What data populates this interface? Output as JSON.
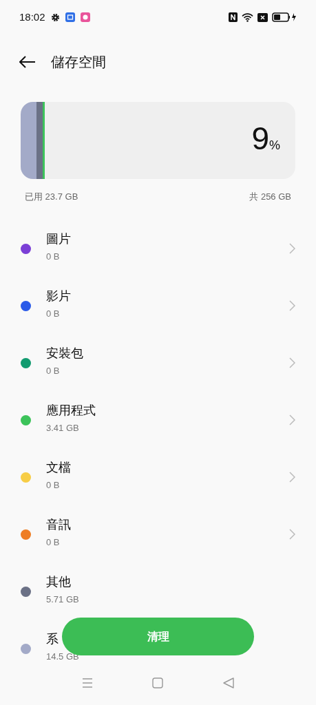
{
  "status_bar": {
    "time": "18:02"
  },
  "header": {
    "title": "儲存空間"
  },
  "usage": {
    "percent": "9",
    "percent_sign": "%",
    "used": "已用 23.7 GB",
    "total": "共 256 GB",
    "segments": [
      {
        "color": "#a3aac8"
      },
      {
        "color": "#6b7186"
      },
      {
        "color": "#3cc35a"
      }
    ]
  },
  "categories": [
    {
      "label": "圖片",
      "size": "0 B",
      "color": "#7b3fd6",
      "chevron": true
    },
    {
      "label": "影片",
      "size": "0 B",
      "color": "#2a5ae8",
      "chevron": true
    },
    {
      "label": "安裝包",
      "size": "0 B",
      "color": "#129b70",
      "chevron": true
    },
    {
      "label": "應用程式",
      "size": "3.41 GB",
      "color": "#3cc35a",
      "chevron": true
    },
    {
      "label": "文檔",
      "size": "0 B",
      "color": "#f7cd46",
      "chevron": true
    },
    {
      "label": "音訊",
      "size": "0 B",
      "color": "#ee7d24",
      "chevron": true
    },
    {
      "label": "其他",
      "size": "5.71 GB",
      "color": "#6b7186",
      "chevron": false
    },
    {
      "label": "系",
      "size": "14.5 GB",
      "color": "#a3aac8",
      "chevron": false
    }
  ],
  "clean_button": {
    "label": "清理"
  }
}
